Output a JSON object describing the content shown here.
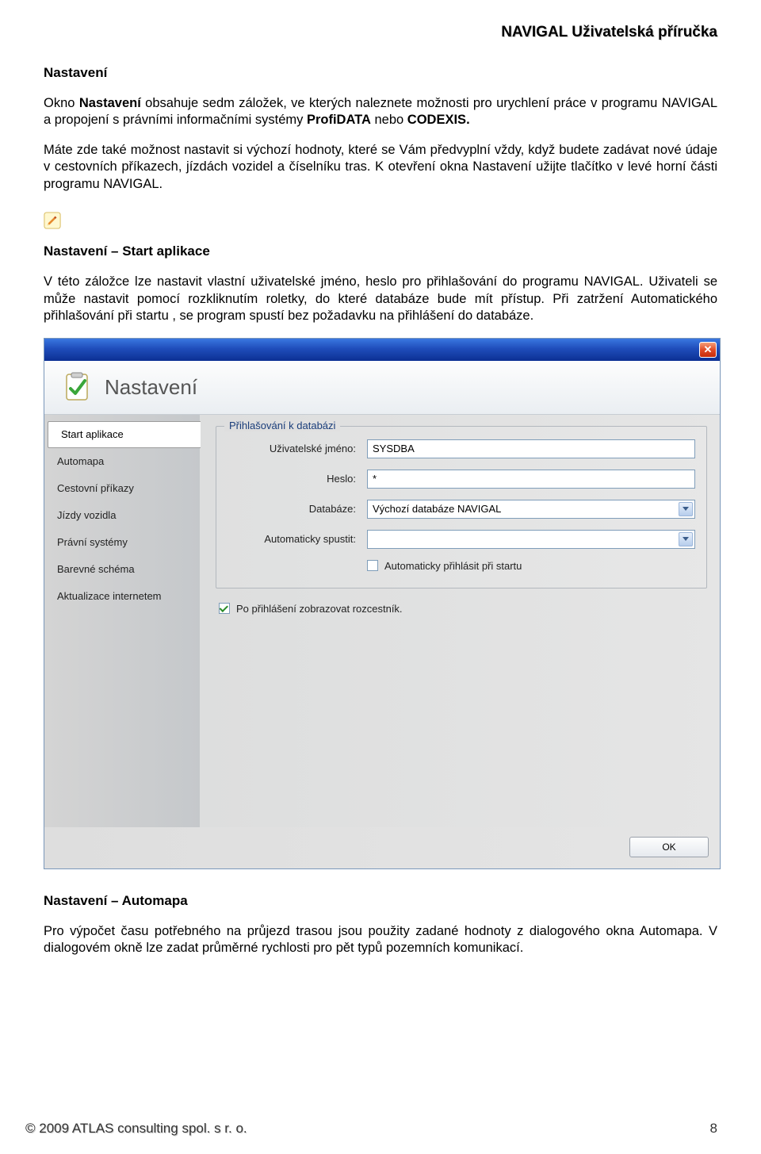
{
  "doc_header": "NAVIGAL    Uživatelská příručka",
  "section1": {
    "title": "Nastavení",
    "p1_a": "Okno ",
    "p1_b": "Nastavení",
    "p1_c": " obsahuje sedm záložek, ve kterých naleznete možnosti pro urychlení práce v programu NAVIGAL a propojení s právními informačními systémy ",
    "p1_d": "ProfiDATA",
    "p1_e": " nebo ",
    "p1_f": "CODEXIS.",
    "p2": "Máte zde také možnost nastavit si výchozí hodnoty, které se Vám předvyplní vždy, když budete zadávat nové údaje v cestovních příkazech, jízdách vozidel a číselníku tras. K otevření okna Nastavení užijte tlačítko v levé horní části programu NAVIGAL."
  },
  "section2": {
    "title": "Nastavení – Start aplikace",
    "p1": "V této záložce lze nastavit vlastní uživatelské jméno, heslo pro přihlašování do programu NAVIGAL. Uživateli se může nastavit pomocí rozkliknutím roletky, do které databáze bude mít přístup. Při zatržení Automatického přihlašování při startu , se program spustí bez požadavku na přihlášení do databáze."
  },
  "dialog": {
    "header_title": "Nastavení",
    "tabs": [
      {
        "label": "Start aplikace"
      },
      {
        "label": "Automapa"
      },
      {
        "label": "Cestovní příkazy"
      },
      {
        "label": "Jízdy vozidla"
      },
      {
        "label": "Právní systémy"
      },
      {
        "label": "Barevné schéma"
      },
      {
        "label": "Aktualizace internetem"
      }
    ],
    "group_legend": "Přihlašování k databázi",
    "labels": {
      "username": "Uživatelské jméno:",
      "password": "Heslo:",
      "database": "Databáze:",
      "autorun": "Automaticky spustit:"
    },
    "values": {
      "username": "SYSDBA",
      "password": "*",
      "database": "Výchozí databáze NAVIGAL",
      "autorun": ""
    },
    "chk_autologin": "Automaticky přihlásit při startu",
    "chk_signpost": "Po přihlášení zobrazovat rozcestník.",
    "ok": "OK"
  },
  "section3": {
    "title": "Nastavení – Automapa",
    "p1": "Pro výpočet času potřebného na průjezd trasou jsou použity zadané hodnoty z dialogového okna Automapa. V dialogovém okně lze zadat průměrné rychlosti pro pět typů pozemních komunikací."
  },
  "footer": {
    "left": "© 2009  ATLAS consulting spol.  s r.  o.",
    "right": "8"
  }
}
